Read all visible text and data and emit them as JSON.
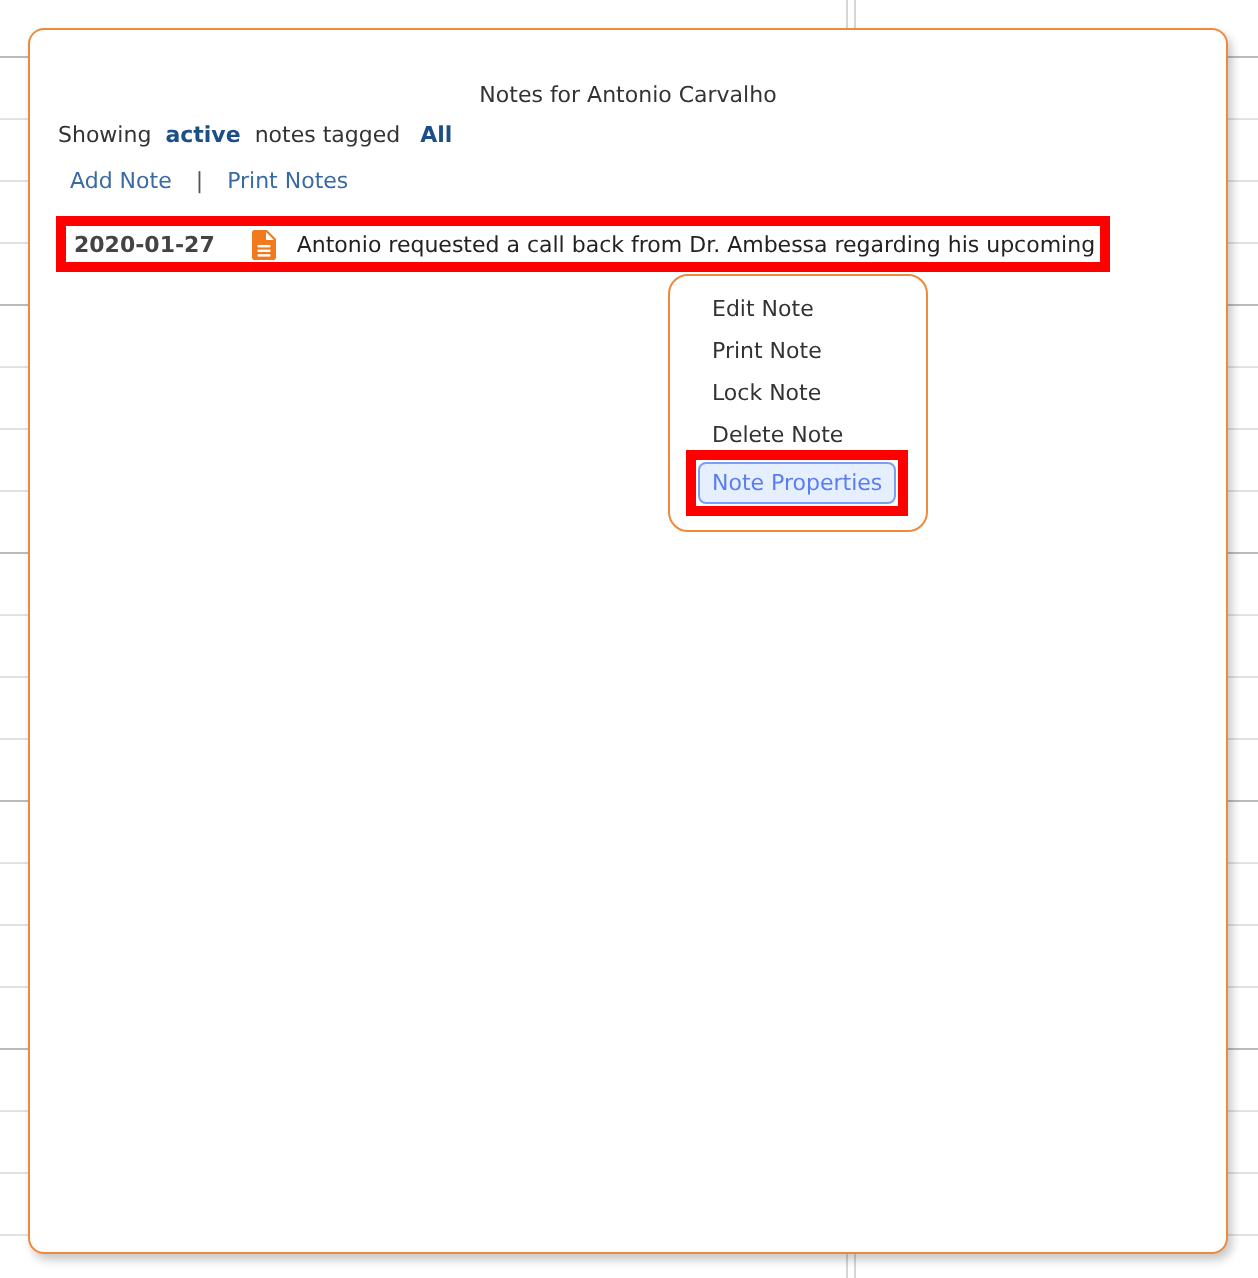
{
  "dialog": {
    "title": "Notes for Antonio Carvalho",
    "filter": {
      "prefix": "Showing",
      "status": "active",
      "middle": "notes tagged",
      "tag": "All"
    },
    "actions": [
      {
        "label": "Add Note"
      },
      {
        "label": "Print Notes"
      }
    ],
    "separator": "|",
    "notes": [
      {
        "date": "2020-01-27",
        "text": "Antonio requested a call back from Dr. Ambessa regarding his upcoming",
        "highlighted": true
      }
    ],
    "context_menu": {
      "items": [
        {
          "label": "Edit Note",
          "selected": false,
          "highlighted": false
        },
        {
          "label": "Print Note",
          "selected": false,
          "highlighted": false
        },
        {
          "label": "Lock Note",
          "selected": false,
          "highlighted": false
        },
        {
          "label": "Delete Note",
          "selected": false,
          "highlighted": false
        },
        {
          "label": "Note Properties",
          "selected": true,
          "highlighted": true
        }
      ]
    }
  }
}
